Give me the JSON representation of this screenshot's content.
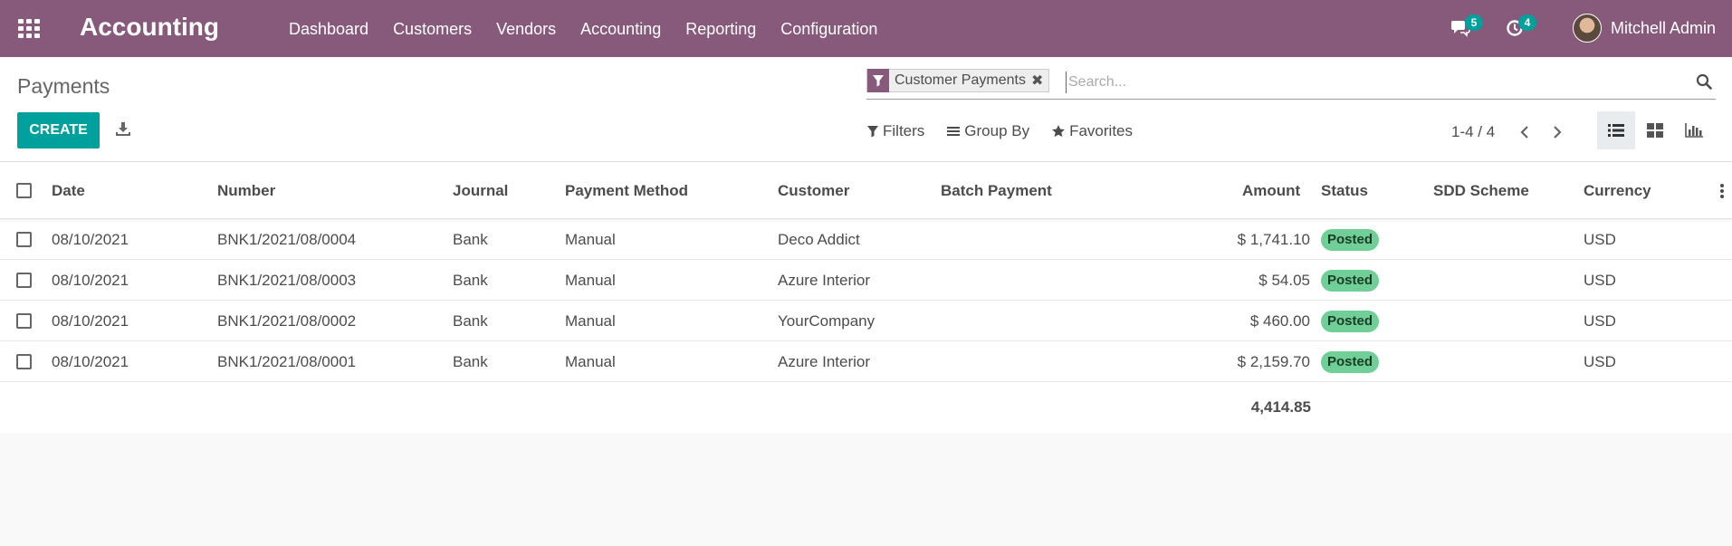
{
  "app": {
    "title": "Accounting"
  },
  "menu": {
    "items": [
      "Dashboard",
      "Customers",
      "Vendors",
      "Accounting",
      "Reporting",
      "Configuration"
    ]
  },
  "systray": {
    "messages_count": "5",
    "activities_count": "4",
    "user_name": "Mitchell Admin"
  },
  "page": {
    "breadcrumb": "Payments",
    "create_label": "CREATE"
  },
  "search": {
    "facet_label": "Customer Payments",
    "placeholder": "Search..."
  },
  "filters": {
    "filters_label": "Filters",
    "group_by_label": "Group By",
    "favorites_label": "Favorites"
  },
  "pager": {
    "value": "1-4 / 4"
  },
  "table": {
    "columns": [
      "Date",
      "Number",
      "Journal",
      "Payment Method",
      "Customer",
      "Batch Payment",
      "Amount",
      "Status",
      "SDD Scheme",
      "Currency"
    ],
    "rows": [
      {
        "date": "08/10/2021",
        "number": "BNK1/2021/08/0004",
        "journal": "Bank",
        "method": "Manual",
        "customer": "Deco Addict",
        "batch": "",
        "amount": "$ 1,741.10",
        "status": "Posted",
        "sdd": "",
        "currency": "USD"
      },
      {
        "date": "08/10/2021",
        "number": "BNK1/2021/08/0003",
        "journal": "Bank",
        "method": "Manual",
        "customer": "Azure Interior",
        "batch": "",
        "amount": "$ 54.05",
        "status": "Posted",
        "sdd": "",
        "currency": "USD"
      },
      {
        "date": "08/10/2021",
        "number": "BNK1/2021/08/0002",
        "journal": "Bank",
        "method": "Manual",
        "customer": "YourCompany",
        "batch": "",
        "amount": "$ 460.00",
        "status": "Posted",
        "sdd": "",
        "currency": "USD"
      },
      {
        "date": "08/10/2021",
        "number": "BNK1/2021/08/0001",
        "journal": "Bank",
        "method": "Manual",
        "customer": "Azure Interior",
        "batch": "",
        "amount": "$ 2,159.70",
        "status": "Posted",
        "sdd": "",
        "currency": "USD"
      }
    ],
    "total_amount": "4,414.85"
  },
  "colors": {
    "brand": "#875a7b",
    "primary": "#00a09d",
    "status_posted": "#6fcf97"
  }
}
